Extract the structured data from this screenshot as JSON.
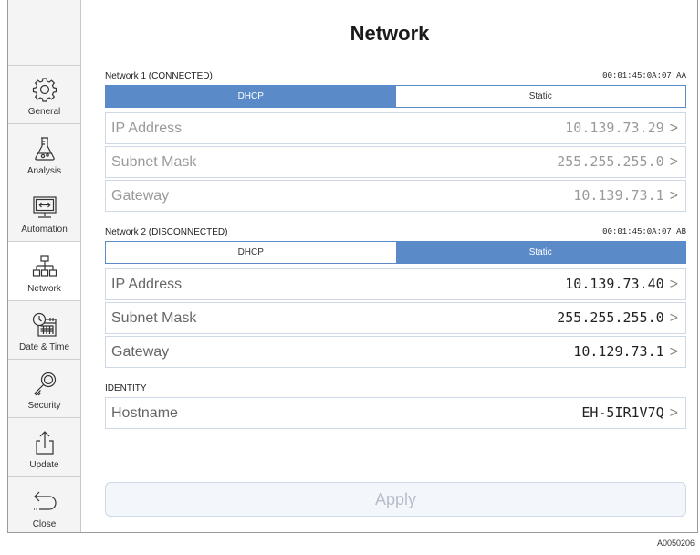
{
  "title": "Network",
  "sidebar": {
    "items": [
      {
        "label": "General",
        "icon": "gear-icon"
      },
      {
        "label": "Analysis",
        "icon": "flask-icon"
      },
      {
        "label": "Automation",
        "icon": "monitor-arrows-icon"
      },
      {
        "label": "Network",
        "icon": "network-icon"
      },
      {
        "label": "Date & Time",
        "icon": "calendar-clock-icon"
      },
      {
        "label": "Security",
        "icon": "key-icon"
      },
      {
        "label": "Update",
        "icon": "upload-icon"
      },
      {
        "label": "Close",
        "icon": "back-arrow-icon"
      }
    ]
  },
  "network1": {
    "header": "Network 1 (CONNECTED)",
    "mac": "00:01:45:0A:07:AA",
    "seg_dhcp": "DHCP",
    "seg_static": "Static",
    "selected": "DHCP",
    "rows": [
      {
        "label": "IP Address",
        "value": "10.139.73.29"
      },
      {
        "label": "Subnet Mask",
        "value": "255.255.255.0"
      },
      {
        "label": "Gateway",
        "value": "10.139.73.1"
      }
    ]
  },
  "network2": {
    "header": "Network 2 (DISCONNECTED)",
    "mac": "00:01:45:0A:07:AB",
    "seg_dhcp": "DHCP",
    "seg_static": "Static",
    "selected": "Static",
    "rows": [
      {
        "label": "IP Address",
        "value": "10.139.73.40"
      },
      {
        "label": "Subnet Mask",
        "value": "255.255.255.0"
      },
      {
        "label": "Gateway",
        "value": "10.129.73.1"
      }
    ]
  },
  "identity": {
    "header": "IDENTITY",
    "hostname_label": "Hostname",
    "hostname_value": "EH-5IR1V7Q"
  },
  "chevron": ">",
  "apply_label": "Apply",
  "figure_code": "A0050206",
  "colors": {
    "accent": "#5b8ac9"
  }
}
